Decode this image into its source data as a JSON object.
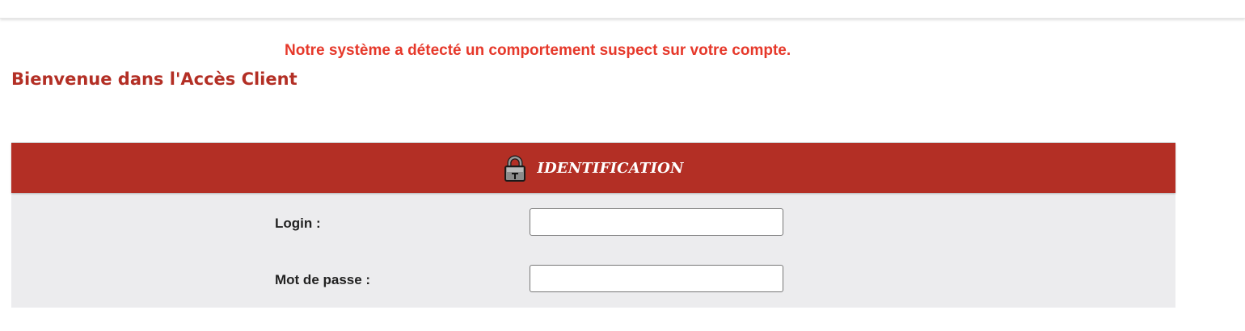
{
  "alert": {
    "text": "Notre système a détecté un comportement suspect sur votre compte.",
    "color": "#e6382a"
  },
  "welcome": {
    "title": "Bienvenue dans l'Accès Client",
    "color": "#b32f25"
  },
  "identification": {
    "icon": "lock-icon",
    "title": "IDENTIFICATION",
    "header_color": "#b32f25",
    "login": {
      "label": "Login :",
      "value": "",
      "placeholder": ""
    },
    "password": {
      "label": "Mot de passe :",
      "value": "",
      "placeholder": ""
    }
  }
}
